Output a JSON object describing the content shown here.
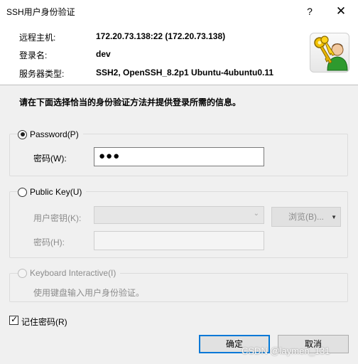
{
  "window": {
    "title": "SSH用户身份验证",
    "help_glyph": "?",
    "close_glyph": "✕"
  },
  "info": {
    "host_label": "远程主机:",
    "host_value": "172.20.73.138:22 (172.20.73.138)",
    "login_label": "登录名:",
    "login_value": "dev",
    "server_type_label": "服务器类型:",
    "server_type_value": "SSH2, OpenSSH_8.2p1 Ubuntu-4ubuntu0.11"
  },
  "instruction": "请在下面选择恰当的身份验证方法并提供登录所需的信息。",
  "password_group": {
    "label": "Password(P)",
    "selected": true,
    "field_label": "密码(W):",
    "masked_value": "●●●"
  },
  "public_key_group": {
    "label": "Public Key(U)",
    "selected": false,
    "key_label": "用户密钥(K):",
    "browse_label": "浏览(B)...",
    "passphrase_label": "密码(H):"
  },
  "keyboard_group": {
    "label": "Keyboard Interactive(I)",
    "description": "使用键盘输入用户身份验证。"
  },
  "remember": {
    "label": "记住密码(R)",
    "checked": true
  },
  "buttons": {
    "ok": "确定",
    "cancel": "取消"
  },
  "watermark": "CSDN @laymen_131"
}
